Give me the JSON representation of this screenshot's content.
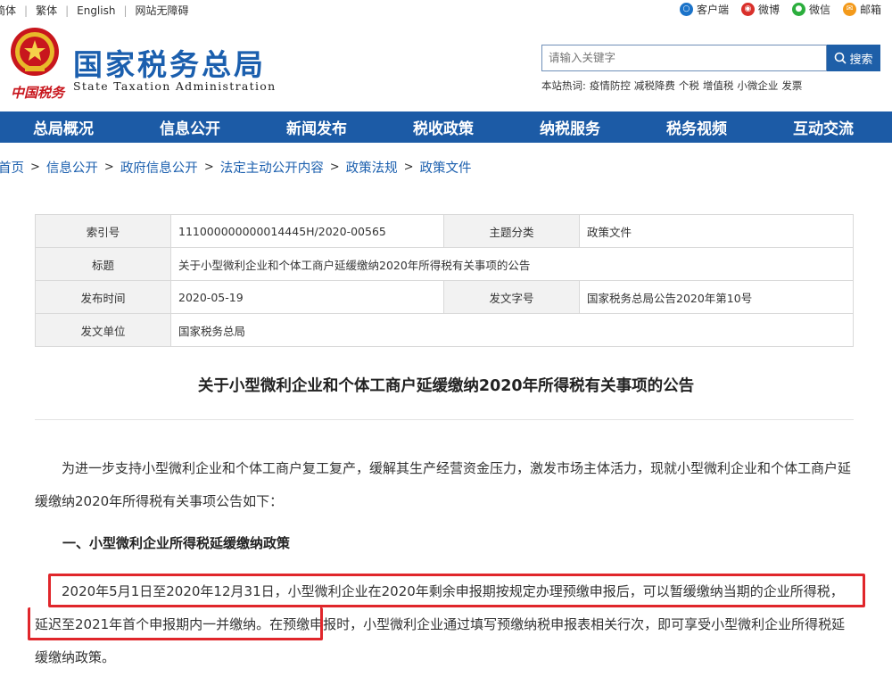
{
  "topbar": {
    "links": [
      "简体",
      "繁体",
      "English",
      "网站无障碍"
    ],
    "social": [
      {
        "icon": "client-icon",
        "label": "客户端",
        "color": "#1b73c9"
      },
      {
        "icon": "weibo-icon",
        "label": "微博",
        "color": "#d9302b"
      },
      {
        "icon": "wechat-icon",
        "label": "微信",
        "color": "#2bae3d"
      },
      {
        "icon": "mail-icon",
        "label": "邮箱",
        "color": "#f39a1b"
      }
    ]
  },
  "header": {
    "logo_text": "中国税务",
    "title": "国家税务总局",
    "subtitle": "State Taxation Administration"
  },
  "search": {
    "placeholder": "请输入关键字",
    "button_label": "搜索",
    "hot_label": "本站热词:",
    "hot_words": [
      "疫情防控",
      "减税降费",
      "个税",
      "增值税",
      "小微企业",
      "发票"
    ]
  },
  "nav": {
    "items": [
      "总局概况",
      "信息公开",
      "新闻发布",
      "税收政策",
      "纳税服务",
      "税务视频",
      "互动交流"
    ]
  },
  "breadcrumb": [
    "首页",
    "信息公开",
    "政府信息公开",
    "法定主动公开内容",
    "政策法规",
    "政策文件"
  ],
  "info": {
    "index_label": "索引号",
    "index_value": "111000000000014445H/2020-00565",
    "topic_label": "主题分类",
    "topic_value": "政策文件",
    "title_label": "标题",
    "title_value": "关于小型微利企业和个体工商户延缓缴纳2020年所得税有关事项的公告",
    "date_label": "发布时间",
    "date_value": "2020-05-19",
    "docno_label": "发文字号",
    "docno_value": "国家税务总局公告2020年第10号",
    "issuer_label": "发文单位",
    "issuer_value": "国家税务总局"
  },
  "article": {
    "title": "关于小型微利企业和个体工商户延缓缴纳2020年所得税有关事项的公告",
    "intro": "为进一步支持小型微利企业和个体工商户复工复产，缓解其生产经营资金压力，激发市场主体活力，现就小型微利企业和个体工商户延缓缴纳2020年所得税有关事项公告如下：",
    "section1_heading": "一、小型微利企业所得税延缓缴纳政策",
    "section1_body": "2020年5月1日至2020年12月31日，小型微利企业在2020年剩余申报期按规定办理预缴申报后，可以暂缓缴纳当期的企业所得税，延迟至2021年首个申报期内一并缴纳。在预缴申报时，小型微利企业通过填写预缴纳税申报表相关行次，即可享受小型微利企业所得税延缓缴纳政策。"
  },
  "colors": {
    "brand_blue": "#1c5ba6",
    "highlight_red": "#e0262b"
  }
}
